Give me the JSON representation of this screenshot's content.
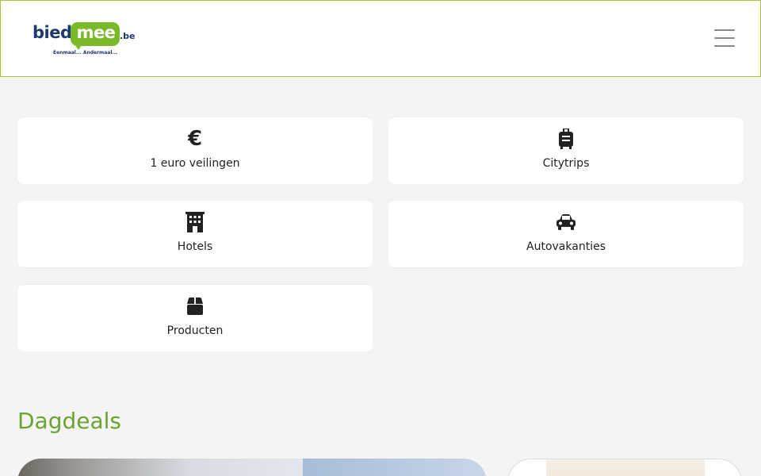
{
  "header": {
    "logo": {
      "bied": "bied",
      "mee": "mee",
      "suffix": ".be",
      "tagline": "Eenmaal... Andermaal..."
    },
    "menu_icon": "hamburger-icon"
  },
  "categories": [
    {
      "label": "1 euro veilingen",
      "icon": "euro-icon"
    },
    {
      "label": "Citytrips",
      "icon": "suitcase-icon"
    },
    {
      "label": "Hotels",
      "icon": "building-icon"
    },
    {
      "label": "Autovakanties",
      "icon": "car-icon"
    },
    {
      "label": "Producten",
      "icon": "box-icon"
    }
  ],
  "sections": {
    "dagdeals_title": "Dagdeals"
  },
  "colors": {
    "brand_green": "#7ab929",
    "brand_navy": "#1d3a6e",
    "section_title": "#6ca431",
    "header_border": "#a6c43a"
  }
}
